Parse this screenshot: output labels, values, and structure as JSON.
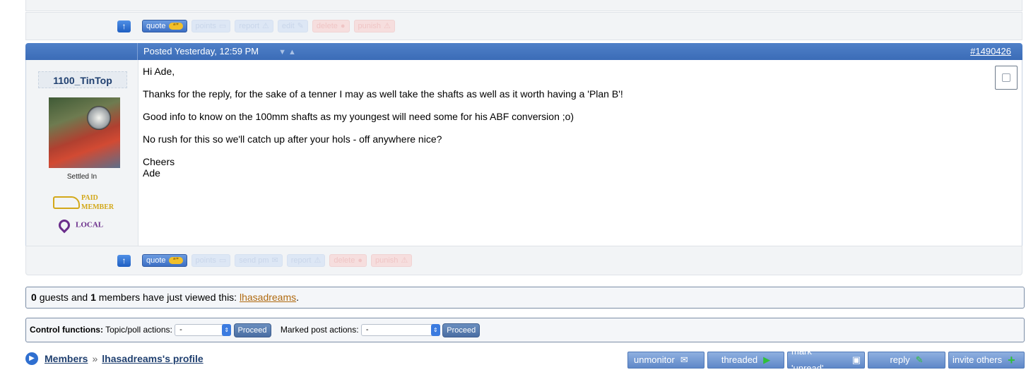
{
  "post_actions": {
    "quote": "quote",
    "points": "points",
    "send_pm": "send pm",
    "report": "report",
    "edit": "edit",
    "delete": "delete",
    "punish": "punish"
  },
  "post": {
    "posted_label": "Posted Yesterday, 12:59 PM",
    "post_id": "#1490426",
    "author": {
      "name": "1100_TinTop",
      "rank": "Settled In",
      "badge_paid_line1": "PAID",
      "badge_paid_line2": "MEMBER",
      "badge_local": "LOCAL"
    },
    "body": {
      "greeting": "Hi Ade,",
      "p1": "Thanks for the reply, for the sake of a tenner I may as well take the shafts as well as it worth having a 'Plan B'!",
      "p2": "Good info to know on the 100mm shafts as my youngest will need some for his ABF conversion ;o)",
      "p3": "No rush for this so we'll catch up after your hols - off anywhere nice?",
      "sign1": "Cheers",
      "sign2": "Ade"
    }
  },
  "viewers": {
    "guests": "0",
    "t1": "guests and",
    "members": "1",
    "t2": "members have just viewed this:",
    "user": "lhasadreams",
    "end": "."
  },
  "control": {
    "label": "Control functions:",
    "topic_label": "Topic/poll actions:",
    "topic_value": "-",
    "proceed": "Proceed",
    "marked_label": "Marked post actions:",
    "marked_value": "-",
    "proceed2": "Proceed"
  },
  "breadcrumb": {
    "members": "Members",
    "sep": "»",
    "profile": "lhasadreams's profile"
  },
  "nav_buttons": {
    "unmonitor": "unmonitor",
    "threaded": "threaded",
    "mark_unread": "mark 'unread'",
    "reply": "reply",
    "invite": "invite others"
  }
}
